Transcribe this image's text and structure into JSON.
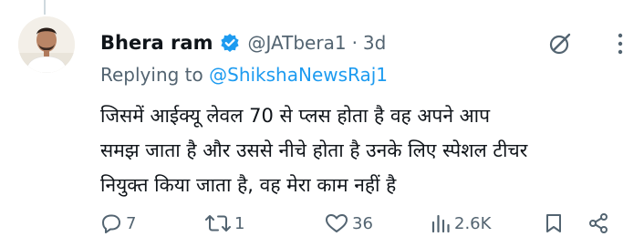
{
  "tweet": {
    "author": {
      "display_name": "Bhera ram",
      "handle": "@JATbera1",
      "separator": "·",
      "time": "3d"
    },
    "replying_prefix": "Replying to ",
    "replying_to": "@ShikshaNewsRaj1",
    "text_lines": [
      "जिसमें आईक्यू लेवल 70 से प्लस होता है वह अपने आप",
      "समझ जाता है और उससे नीचे होता है उनके लिए स्पेशल टीचर",
      "नियुक्त किया जाता है, वह मेरा काम नहीं है"
    ],
    "stats": {
      "replies": "7",
      "reposts": "1",
      "likes": "36",
      "views": "2.6K"
    }
  },
  "colors": {
    "text": "#0f1419",
    "secondary": "#536471",
    "accent": "#1d9bf0"
  },
  "icons": [
    "verified-badge-icon",
    "grok-icon",
    "more-icon",
    "reply-icon",
    "repost-icon",
    "like-icon",
    "views-icon",
    "bookmark-icon",
    "share-icon"
  ]
}
